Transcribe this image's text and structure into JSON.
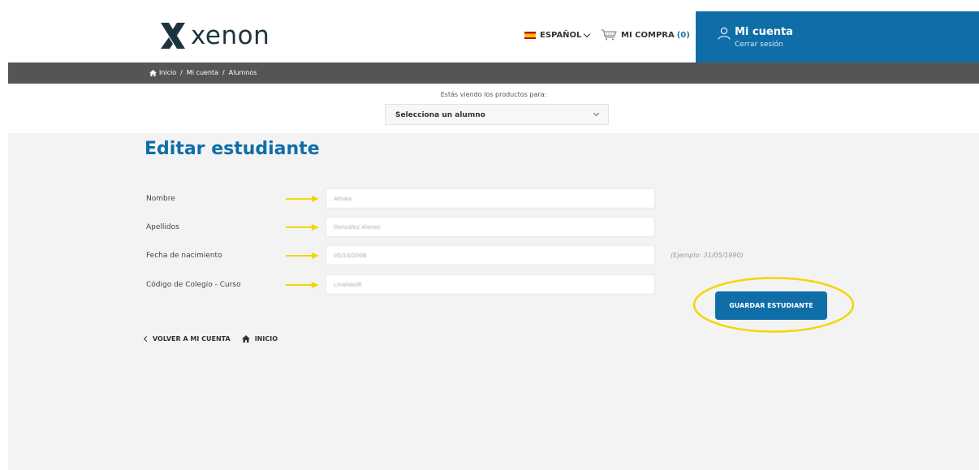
{
  "header": {
    "logo_text": "xenon",
    "language": "ESPAÑOL",
    "cart_label": "MI COMPRA",
    "cart_count": "(0)",
    "account_title": "Mi cuenta",
    "account_logout": "Cerrar sesión"
  },
  "breadcrumb": {
    "items": [
      "Inicio",
      "Mi cuenta",
      "Alumnos"
    ],
    "separator": "/"
  },
  "selector": {
    "label": "Estás viendo los productos para:",
    "value": "Selecciona un alumno"
  },
  "form": {
    "title": "Editar estudiante",
    "fields": [
      {
        "label": "Nombre",
        "value": "Amaia"
      },
      {
        "label": "Apellidos",
        "value": "González Alonso"
      },
      {
        "label": "Fecha de nacimiento",
        "value": "05/10/2008",
        "hint": "(Ejemplo: 31/05/1990)"
      },
      {
        "label": "Código de Colegio - Curso",
        "value": "LinaHAUR"
      }
    ],
    "save_label": "GUARDAR ESTUDIANTE"
  },
  "footer_links": {
    "back_label": "VOLVER A MI CUENTA",
    "home_label": "INICIO"
  },
  "colors": {
    "brand_blue": "#0f6ea8",
    "breadcrumb_bg": "#555555",
    "annotation_yellow": "#f2d600",
    "page_bg": "#f3f3f3"
  },
  "icons": [
    "xenon-logo-icon",
    "spain-flag-icon",
    "chevron-down-icon",
    "cart-icon",
    "user-icon",
    "home-icon",
    "arrow-right-icon",
    "chevron-left-icon"
  ]
}
